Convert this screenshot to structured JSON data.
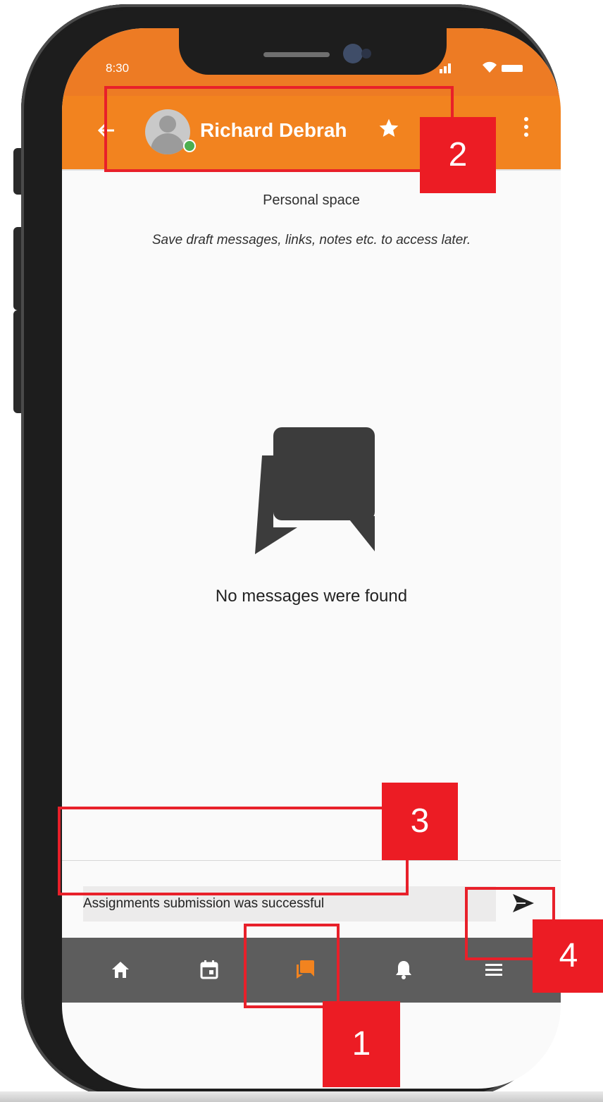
{
  "status_bar": {
    "time": "8:30"
  },
  "header": {
    "contact_name": "Richard Debrah",
    "presence": "online"
  },
  "content": {
    "title": "Personal space",
    "subtitle": "Save draft messages, links, notes etc. to access later.",
    "empty_message": "No messages were found"
  },
  "composer": {
    "value": "Assignments submission was successful"
  },
  "bottom_nav": [
    {
      "icon": "home-icon"
    },
    {
      "icon": "calendar-icon"
    },
    {
      "icon": "chat-icon",
      "active": true
    },
    {
      "icon": "bell-icon"
    },
    {
      "icon": "menu-icon"
    }
  ],
  "annotations": [
    "1",
    "2",
    "3",
    "4"
  ],
  "colors": {
    "app_bar": "#f2831f",
    "status_bar": "#ed7b24",
    "nav_bar": "#5d5d5d",
    "annotation": "#e8202a",
    "badge": "#ec1c24"
  }
}
